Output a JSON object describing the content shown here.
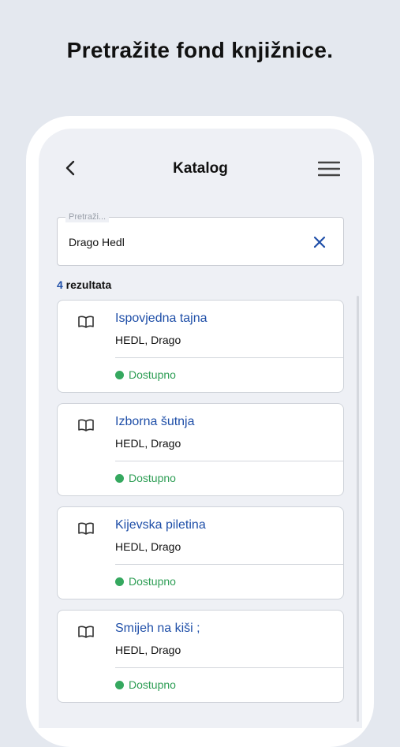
{
  "headline": "Pretražite fond knjižnice.",
  "header": {
    "title": "Katalog",
    "back_icon": "chevron-left-icon",
    "menu_icon": "hamburger-menu-icon"
  },
  "search": {
    "label": "Pretraži...",
    "value": "Drago Hedl",
    "clear_icon": "close-icon"
  },
  "results": {
    "count": "4",
    "count_label": " rezultata"
  },
  "items": [
    {
      "title": "Ispovjedna tajna",
      "author": "HEDL, Drago",
      "status": "Dostupno"
    },
    {
      "title": "Izborna šutnja",
      "author": "HEDL, Drago",
      "status": "Dostupno"
    },
    {
      "title": "Kijevska piletina",
      "author": "HEDL, Drago",
      "status": "Dostupno"
    },
    {
      "title": "Smijeh na kiši ;",
      "author": "HEDL, Drago",
      "status": "Dostupno"
    }
  ],
  "colors": {
    "accent": "#1f4fa8",
    "available": "#35a85f",
    "background": "#e4e8ef"
  }
}
